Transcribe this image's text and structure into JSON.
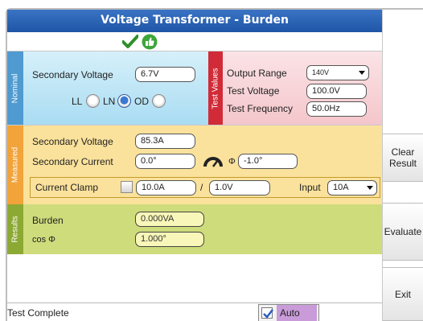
{
  "window": {
    "title": "Voltage Transformer - Burden"
  },
  "status_icons": {
    "ok": "check-icon",
    "approval": "thumbs-up-icon"
  },
  "nominal": {
    "section_label": "Nominal",
    "secondary_voltage_label": "Secondary Voltage",
    "secondary_voltage_value": "6.7V",
    "ll_label": "LL",
    "ln_label": "LN",
    "od_label": "OD",
    "selected_connection": "LN"
  },
  "test_values": {
    "section_label": "Test Values",
    "output_range_label": "Output Range",
    "output_range_value": "140V",
    "test_voltage_label": "Test Voltage",
    "test_voltage_value": "100.0V",
    "test_frequency_label": "Test Frequency",
    "test_frequency_value": "50.0Hz"
  },
  "measured": {
    "section_label": "Measured",
    "secondary_voltage_label": "Secondary Voltage",
    "secondary_voltage_value": "85.3A",
    "secondary_current_label": "Secondary Current",
    "secondary_current_value": "0.0°",
    "phi_symbol": "Φ",
    "phi_value": "-1.0°",
    "current_clamp_label": "Current Clamp",
    "clamp_current_value": "10.0A",
    "separator": "/",
    "clamp_voltage_value": "1.0V",
    "input_label": "Input",
    "input_value": "10A"
  },
  "results": {
    "section_label": "Results",
    "burden_label": "Burden",
    "burden_value": "0.000VA",
    "cos_phi_label": "cos Φ",
    "cos_phi_value": "1.000°"
  },
  "status_bar": {
    "message": "Test Complete",
    "auto_label": "Auto",
    "auto_checked": true
  },
  "buttons": {
    "clear_result": "Clear Result",
    "evaluate": "Evaluate",
    "exit": "Exit"
  },
  "colors": {
    "title_bar": "#2a63b5",
    "nominal": "#bfe6f6",
    "test_values": "#f4c6cb",
    "measured": "#fbe29c",
    "results": "#cfdc7b"
  }
}
